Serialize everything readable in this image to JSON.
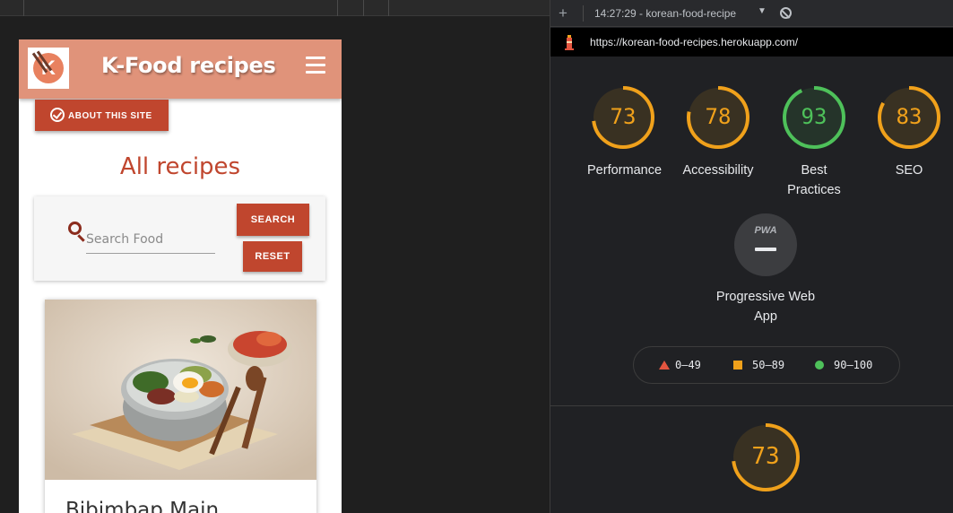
{
  "site": {
    "brand": "K-Food recipes",
    "about_button": "ABOUT THIS SITE",
    "heading": "All recipes",
    "search": {
      "placeholder": "Search Food",
      "value": "",
      "search_button": "SEARCH",
      "reset_button": "RESET"
    },
    "recipe_card": {
      "title": "Bibimbap Main"
    }
  },
  "devtools": {
    "report_selector": "14:27:29 - korean-food-recipe",
    "url": "https://korean-food-recipes.herokuapp.com/",
    "categories": [
      {
        "label": "Performance",
        "score": "73",
        "value": 73,
        "color": "#f0a11b"
      },
      {
        "label": "Accessibility",
        "score": "78",
        "value": 78,
        "color": "#f0a11b"
      },
      {
        "label": "Best Practices",
        "score": "93",
        "value": 93,
        "color": "#4ec15a"
      },
      {
        "label": "SEO",
        "score": "83",
        "value": 83,
        "color": "#f0a11b"
      }
    ],
    "pwa": {
      "badge": "PWA",
      "label": "Progressive Web App"
    },
    "legend": {
      "fail": "0–49",
      "average": "50–89",
      "pass": "90–100"
    },
    "section_gauge": {
      "score": "73",
      "value": 73,
      "color": "#f0a11b"
    },
    "colors": {
      "fail": "#e4553f",
      "average": "#f0a11b",
      "pass": "#4ec15a",
      "accent": "#c0462e",
      "navbar": "#e0937a"
    }
  }
}
